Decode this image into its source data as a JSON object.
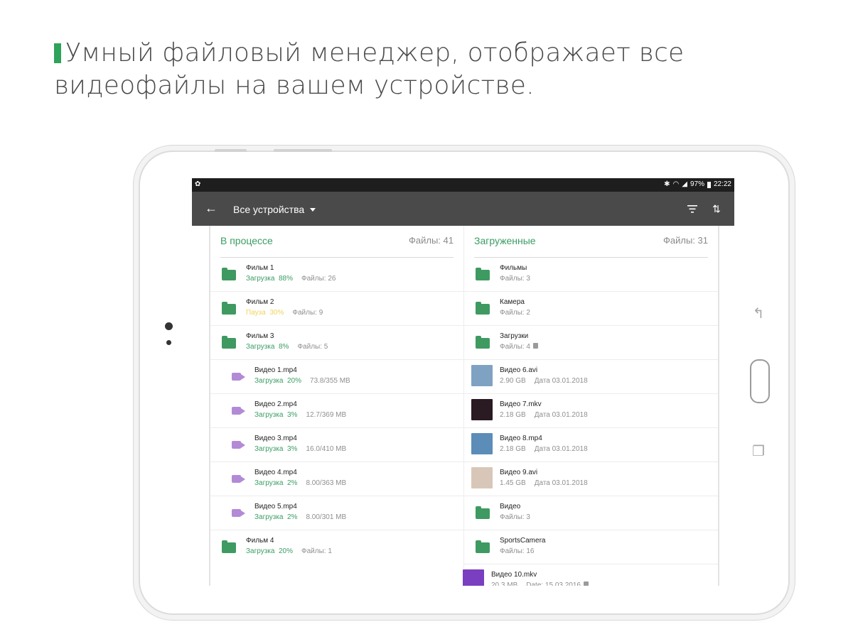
{
  "headline": "Умный файловый менеджер, отображает все видеофайлы на вашем устройстве.",
  "status_bar": {
    "icons": [
      "app-icon",
      "bluetooth-icon",
      "wifi-icon",
      "signal-icon",
      "battery-icon"
    ],
    "battery": "97%",
    "time": "22:22"
  },
  "app_bar": {
    "title": "Все устройства",
    "icons": [
      "back-arrow-icon",
      "dropdown-caret-icon",
      "filter-icon",
      "sort-icon"
    ]
  },
  "in_progress": {
    "title": "В процессе",
    "count": "Файлы: 41",
    "items": [
      {
        "name": "Фильм 1",
        "status": "Загрузка  88%",
        "status_kind": "green",
        "meta": "Файлы: 26",
        "icon": "folder-icon"
      },
      {
        "name": "Фильм 2",
        "status": "Пауза  30%",
        "status_kind": "yellow",
        "meta": "Файлы: 9",
        "icon": "folder-icon"
      },
      {
        "name": "Фильм 3",
        "status": "Загрузка  8%",
        "status_kind": "green",
        "meta": "Файлы: 5",
        "icon": "folder-icon"
      },
      {
        "name": "Видео 1.mp4",
        "status": "Загрузка  20%",
        "status_kind": "green",
        "meta": "73.8/355 MB",
        "icon": "video-camera-icon"
      },
      {
        "name": "Видео 2.mp4",
        "status": "Загрузка  3%",
        "status_kind": "green",
        "meta": "12.7/369 MB",
        "icon": "video-camera-icon"
      },
      {
        "name": "Видео 3.mp4",
        "status": "Загрузка  3%",
        "status_kind": "green",
        "meta": "16.0/410 MB",
        "icon": "video-camera-icon"
      },
      {
        "name": "Видео 4.mp4",
        "status": "Загрузка  2%",
        "status_kind": "green",
        "meta": "8.00/363 MB",
        "icon": "video-camera-icon"
      },
      {
        "name": "Видео 5.mp4",
        "status": "Загрузка  2%",
        "status_kind": "green",
        "meta": "8.00/301 MB",
        "icon": "video-camera-icon"
      },
      {
        "name": "Фильм 4",
        "status": "Загрузка  20%",
        "status_kind": "green",
        "meta": "Файлы: 1",
        "icon": "folder-icon"
      }
    ]
  },
  "downloaded": {
    "title": "Загруженные",
    "count": "Файлы: 31",
    "items": [
      {
        "name": "Фильмы",
        "sub": "Файлы: 3",
        "date": "",
        "icon": "folder-icon"
      },
      {
        "name": "Камера",
        "sub": "Файлы: 2",
        "date": "",
        "icon": "folder-icon"
      },
      {
        "name": "Загрузки",
        "sub": "Файлы: 4",
        "date": "",
        "icon": "folder-icon",
        "sd": true
      },
      {
        "name": "Видео 6.avi",
        "sub": "2.90 GB",
        "date": "Дата 03.01.2018",
        "icon": "video-thumbnail-icon",
        "thumb_color": "#7fa2c2"
      },
      {
        "name": "Видео 7.mkv",
        "sub": "2.18 GB",
        "date": "Дата 03.01.2018",
        "icon": "video-thumbnail-icon",
        "thumb_color": "#2a1a22"
      },
      {
        "name": "Видео 8.mp4",
        "sub": "2.18 GB",
        "date": "Дата 03.01.2018",
        "icon": "video-thumbnail-icon",
        "thumb_color": "#5b8db8"
      },
      {
        "name": "Видео 9.avi",
        "sub": "1.45 GB",
        "date": "Дата 03.01.2018",
        "icon": "video-thumbnail-icon",
        "thumb_color": "#d8c7b8"
      },
      {
        "name": "Видео",
        "sub": "Файлы: 3",
        "date": "",
        "icon": "folder-icon"
      },
      {
        "name": "SportsCamera",
        "sub": "Файлы: 16",
        "date": "",
        "icon": "folder-icon"
      },
      {
        "name": "Видео 10.mkv",
        "sub": "20.3 MB",
        "date": "Date: 15.03.2016",
        "icon": "video-thumbnail-icon",
        "thumb_color": "#7a3ec0",
        "sd": true
      }
    ]
  },
  "device_buttons": [
    "recent-apps-icon",
    "home-button",
    "back-nav-icon"
  ],
  "colors": {
    "accent": "#3a9d63",
    "paused": "#f2d35c",
    "video_icon": "#b28ad6",
    "app_bar": "#4a4a4a"
  }
}
